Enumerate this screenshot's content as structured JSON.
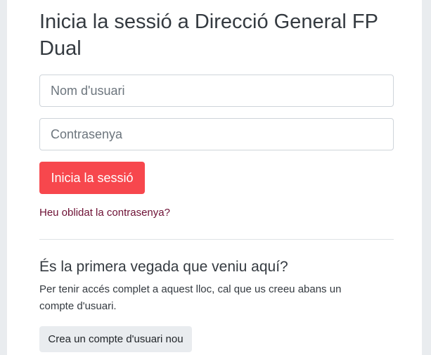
{
  "login": {
    "title": "Inicia la sessió a Direcció General FP Dual",
    "username_placeholder": "Nom d'usuari",
    "username_value": "",
    "password_placeholder": "Contrasenya",
    "password_value": "",
    "submit_label": "Inicia la sessió",
    "forgot_link": "Heu oblidat la contrasenya?"
  },
  "signup": {
    "heading": "És la primera vegada que veniu aquí?",
    "description": "Per tenir accés complet a aquest lloc, cal que us creeu abans un compte d'usuari.",
    "create_button": "Crea un compte d'usuari nou"
  },
  "colors": {
    "primary_button": "#f7474d",
    "link": "#6d1034",
    "secondary_button": "#e9ecef",
    "page_background": "#e9ecef"
  }
}
